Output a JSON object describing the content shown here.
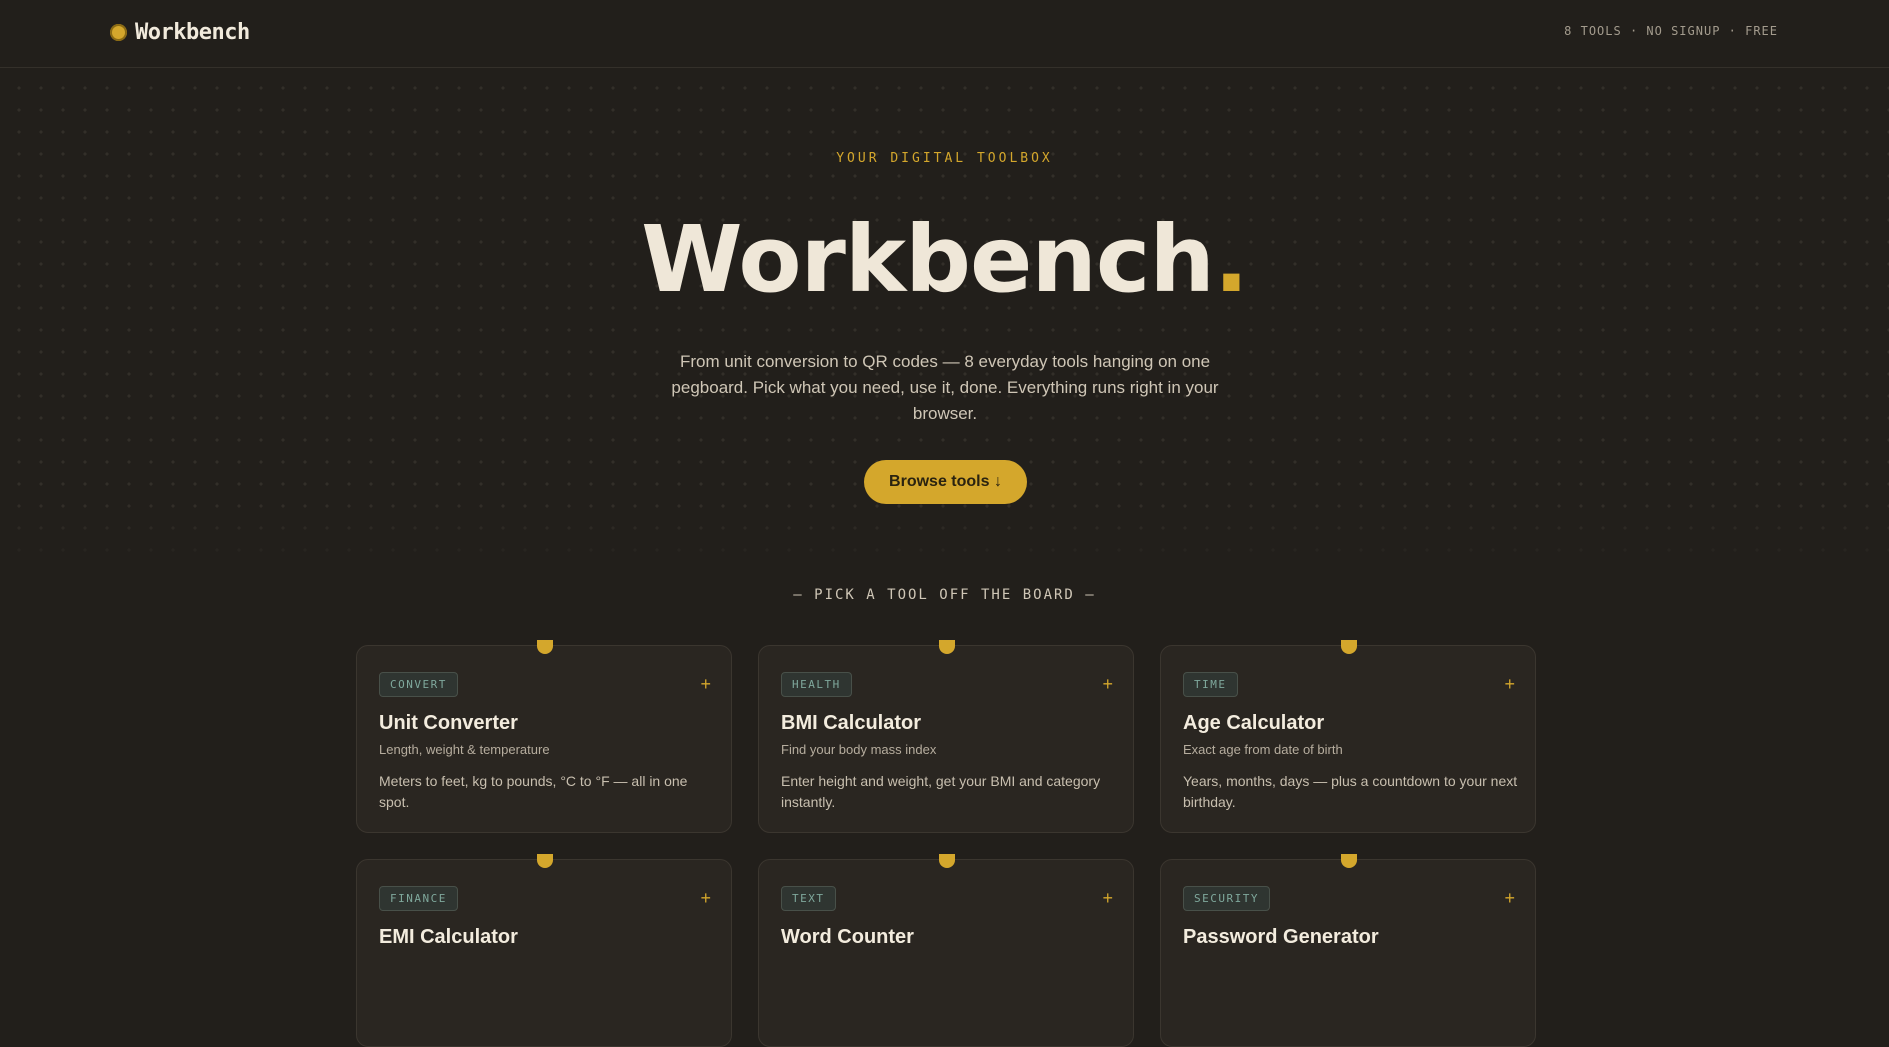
{
  "header": {
    "brand": "Workbench",
    "meta": "8 TOOLS · NO SIGNUP · FREE"
  },
  "hero": {
    "eyebrow": "YOUR DIGITAL TOOLBOX",
    "title": "Workbench",
    "title_accent": ".",
    "description": "From unit conversion to QR codes — 8 everyday tools hanging on one pegboard. Pick what you need, use it, done. Everything runs right in your browser.",
    "cta_label": "Browse tools ↓"
  },
  "section": {
    "label": "— PICK A TOOL OFF THE BOARD —"
  },
  "tools": [
    {
      "tag": "CONVERT",
      "title": "Unit Converter",
      "subtitle": "Length, weight & temperature",
      "description": "Meters to feet, kg to pounds, °C to °F — all in one spot."
    },
    {
      "tag": "HEALTH",
      "title": "BMI Calculator",
      "subtitle": "Find your body mass index",
      "description": "Enter height and weight, get your BMI and category instantly."
    },
    {
      "tag": "TIME",
      "title": "Age Calculator",
      "subtitle": "Exact age from date of birth",
      "description": "Years, months, days — plus a countdown to your next birthday."
    },
    {
      "tag": "FINANCE",
      "title": "EMI Calculator",
      "subtitle": "",
      "description": ""
    },
    {
      "tag": "TEXT",
      "title": "Word Counter",
      "subtitle": "",
      "description": ""
    },
    {
      "tag": "SECURITY",
      "title": "Password Generator",
      "subtitle": "",
      "description": ""
    }
  ],
  "colors": {
    "background": "#221f1b",
    "accent": "#d4a72c",
    "card": "#2a2621",
    "tag_text": "#7fa89c"
  }
}
